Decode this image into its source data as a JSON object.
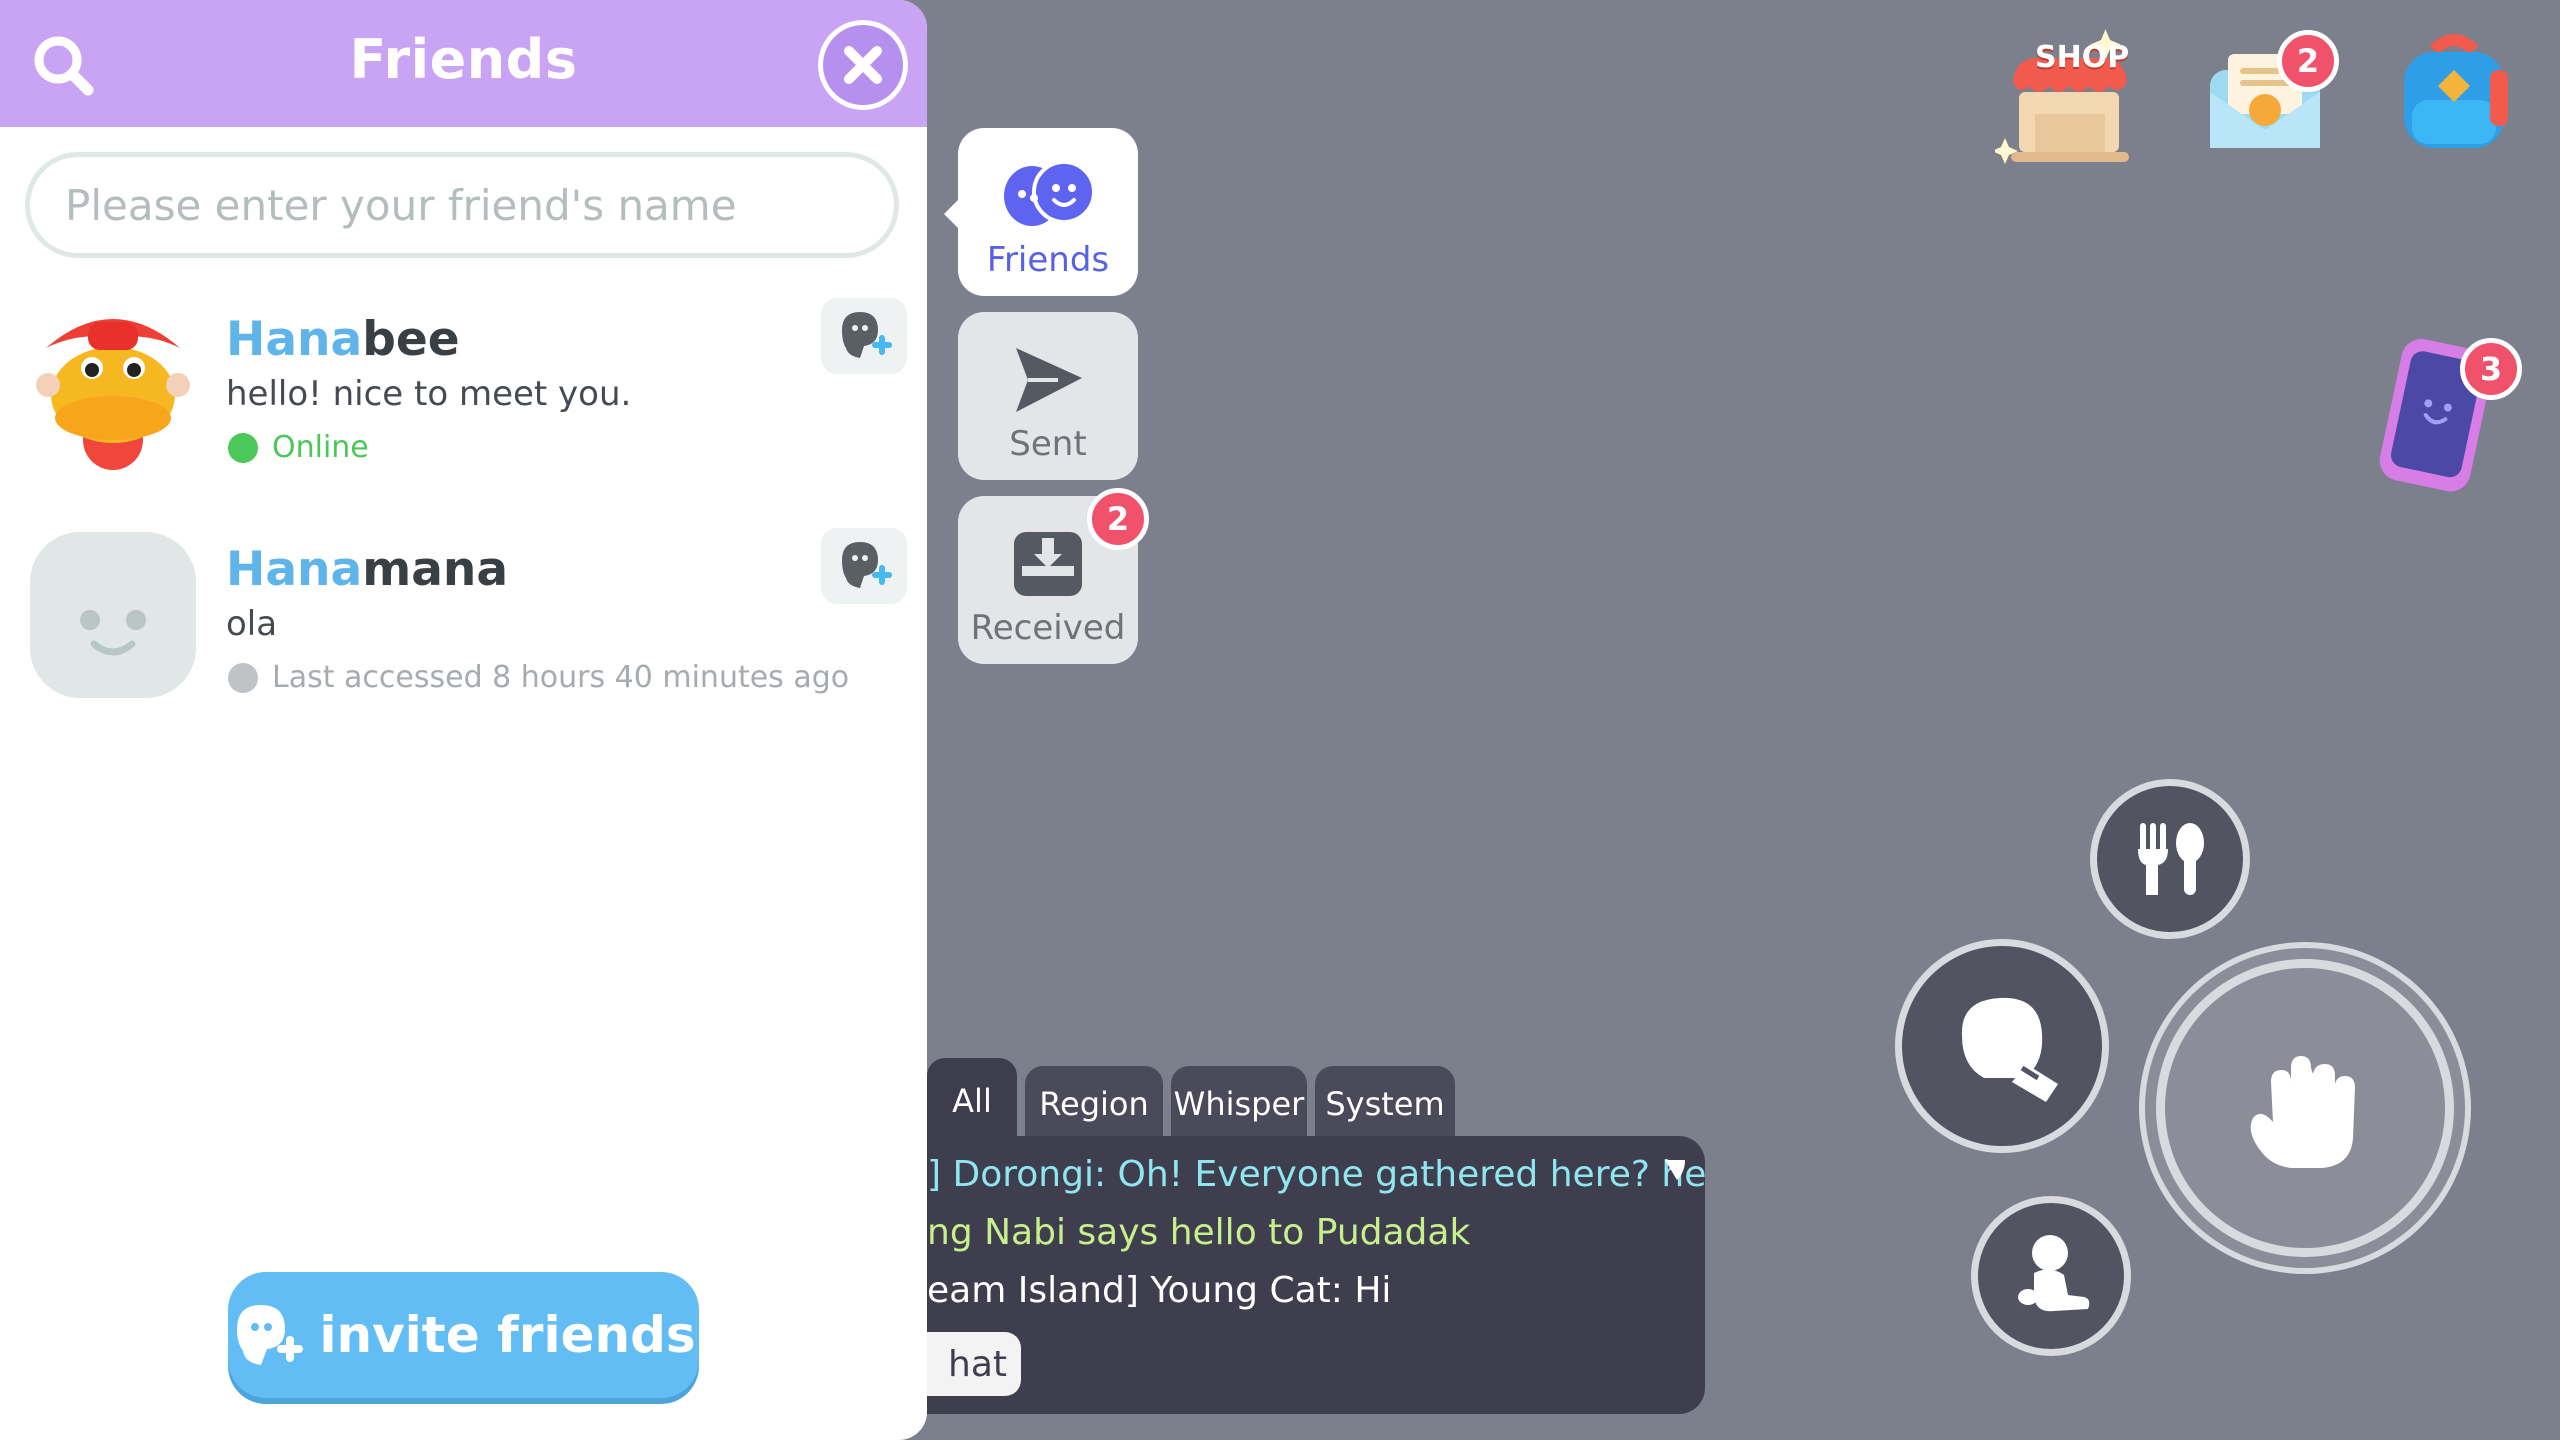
{
  "panel": {
    "title": "Friends",
    "search_placeholder": "Please enter your friend's name",
    "invite_label": "invite friends"
  },
  "friends": [
    {
      "name_highlight": "Hana",
      "name_rest": "bee",
      "message": "hello! nice to meet you.",
      "status": "Online",
      "status_color": "#4cc85a"
    },
    {
      "name_highlight": "Hana",
      "name_rest": "mana",
      "message": "ola",
      "status": "Last accessed 8 hours 40 minutes ago",
      "status_color": "#bfc3c5"
    }
  ],
  "side_tabs": [
    {
      "label": "Friends",
      "active": true
    },
    {
      "label": "Sent",
      "active": false
    },
    {
      "label": "Received",
      "active": false,
      "badge": "2"
    }
  ],
  "chat": {
    "tabs": [
      "All",
      "Region",
      "Whisper",
      "System"
    ],
    "lines": [
      {
        "text": "] Dorongi: Oh! Everyone gathered here? he~",
        "color": "#8fe6ee"
      },
      {
        "text": "ng Nabi says hello to Pudadak",
        "color": "#c6f08a"
      },
      {
        "text": "eam Island] Young Cat: Hi",
        "color": "#ffffff"
      }
    ],
    "input_label": "hat"
  },
  "hud": {
    "shop_label": "SHOP",
    "mail_badge": "2",
    "phone_badge": "3"
  },
  "colors": {
    "header": "#c9a4f5",
    "accent_blue": "#62bdf5",
    "badge_red": "#f0526c",
    "background": "#7c7f8c"
  }
}
